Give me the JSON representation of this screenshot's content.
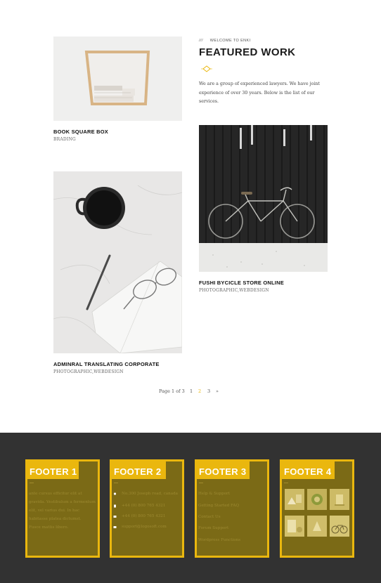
{
  "intro": {
    "kicker_prefix": "///",
    "kicker": "WELCOME TO ENKI",
    "title": "FEATURED WORK",
    "text": "We are a group of experienced lawyers. We have joint experience of over 30 years. Below is the list of our services."
  },
  "portfolio": [
    {
      "title": "BOOK SQUARE BOX",
      "category": "BRADING"
    },
    {
      "title": "FUSHI BYCICLE STORE ONLINE",
      "category": "PHOTOGRAPHIC,WEBDESIGN"
    },
    {
      "title": "ADMINRAL TRANSLATING CORPORATE",
      "category": "PHOTOGRAPHIC,WEBDESIGN"
    }
  ],
  "pagination": {
    "summary": "Page 1 of 3",
    "pages": [
      "1",
      "2",
      "3"
    ],
    "current": "2",
    "next": "»"
  },
  "footer": {
    "columns": [
      {
        "title": "FOOTER 1",
        "lines": [
          "ante cursus efficitur elit at",
          "gravida. Vestibulum a fermentum",
          "elit, vel varius dui. In hac",
          "habitasse platea dictumst.",
          "Fusce mattis libero."
        ]
      },
      {
        "title": "FOOTER 2",
        "lines": [
          "No.300 Joseph road, canada",
          "+44 (0) 800 765 4321",
          "+44 (0) 800 765 4321",
          "support@logosoft.com"
        ],
        "icons": [
          "map-pin-icon",
          "phone-icon",
          "fax-icon",
          "mail-icon"
        ]
      },
      {
        "title": "FOOTER 3",
        "lines": [
          "Help & Support",
          "Getting Started FAQ",
          "Contact Us",
          "Forum Support",
          "Wordpress Functions"
        ]
      },
      {
        "title": "FOOTER 4",
        "gallery": [
          "gallery-photo-1",
          "gallery-photo-2",
          "gallery-photo-3",
          "gallery-photo-4",
          "gallery-photo-5",
          "gallery-photo-6"
        ]
      }
    ]
  },
  "colors": {
    "accent": "#eab70e",
    "footer_bg": "#323232",
    "footer_panel": "#7b6a16",
    "pager_current": "#eab70e"
  }
}
